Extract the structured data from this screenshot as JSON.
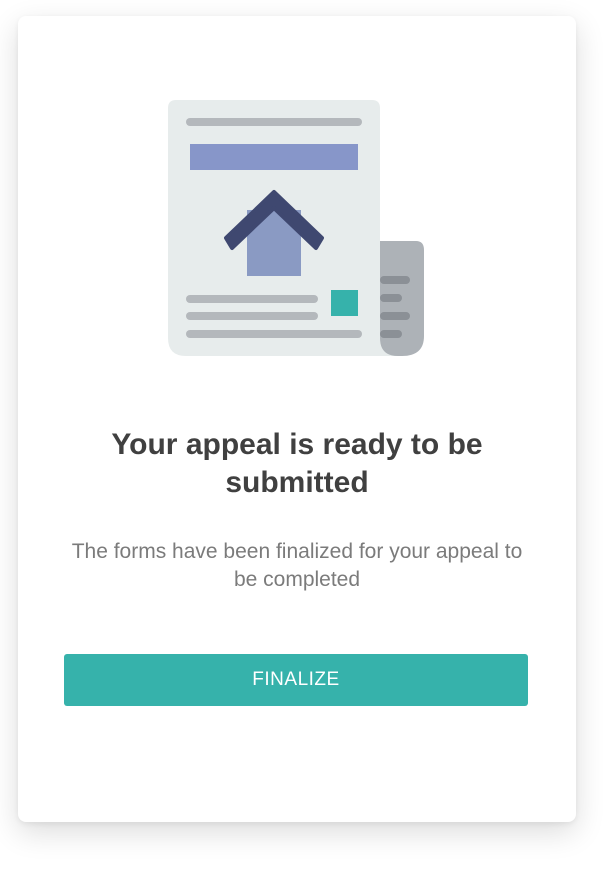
{
  "colors": {
    "accent": "#36b2ab",
    "title": "#404040",
    "subtitle": "#7b7b7b",
    "paper": "#e7ecec",
    "paper_lines": "#b4b8bc",
    "banner": "#8796c9",
    "roof": "#3f4870",
    "house": "#8a9ac3",
    "scroll": "#adb2b7",
    "scroll_lines": "#8b9096",
    "teal_square": "#36b2ab"
  },
  "illustration": {
    "icon_name": "document-house-icon"
  },
  "dialog": {
    "title": "Your appeal is ready to be submitted",
    "description": "The forms have been finalized for your appeal to be completed",
    "button_label": "FINALIZE"
  }
}
